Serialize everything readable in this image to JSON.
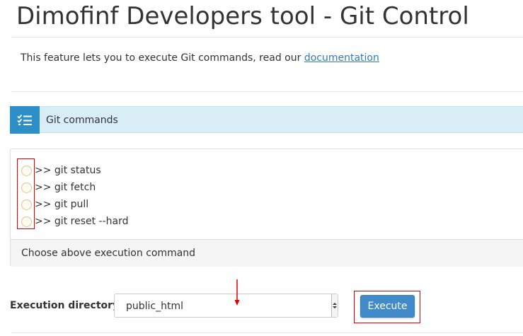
{
  "page": {
    "title": "Dimofinf Developers tool - Git Control",
    "intro_text": "This feature lets you to execute Git commands, read our ",
    "intro_link": "documentation"
  },
  "commands_section": {
    "title": "Git commands",
    "icon": "checklist-icon",
    "commands": [
      {
        "label": ">> git status",
        "selected": false
      },
      {
        "label": ">> git fetch",
        "selected": false
      },
      {
        "label": ">> git pull",
        "selected": false
      },
      {
        "label": ">> git reset --hard",
        "selected": false
      }
    ],
    "footer_text": "Choose above execution command"
  },
  "execution": {
    "directory_label": "Execution directory",
    "directory_value": "public_html",
    "execute_label": "Execute"
  },
  "colors": {
    "callout_bg": "#d9edf7",
    "callout_icon_bg": "#2d8fc7",
    "link": "#337ab7",
    "primary_button": "#428bca",
    "annotation_red": "#e00000"
  }
}
